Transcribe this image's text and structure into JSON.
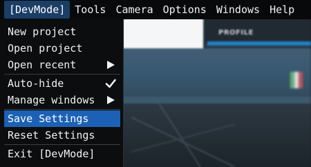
{
  "menubar": {
    "items": [
      {
        "label": "[DevMode]"
      },
      {
        "label": "Tools"
      },
      {
        "label": "Camera"
      },
      {
        "label": "Options"
      },
      {
        "label": "Windows"
      },
      {
        "label": "Help"
      }
    ]
  },
  "dropdown": {
    "new_project": "New project",
    "open_project": "Open project",
    "open_recent": "Open recent",
    "auto_hide": "Auto-hide",
    "auto_hide_checked": true,
    "manage_windows": "Manage windows",
    "save_settings": "Save Settings",
    "reset_settings": "Reset Settings",
    "exit": "Exit [DevMode]"
  },
  "background": {
    "profile_label": "PROFILE"
  },
  "colors": {
    "menubar_bg": "#07090b",
    "active_menu_bg": "#1b3e66",
    "highlight_bg": "#1c61b5",
    "accent_blue": "#1f7fc6"
  }
}
